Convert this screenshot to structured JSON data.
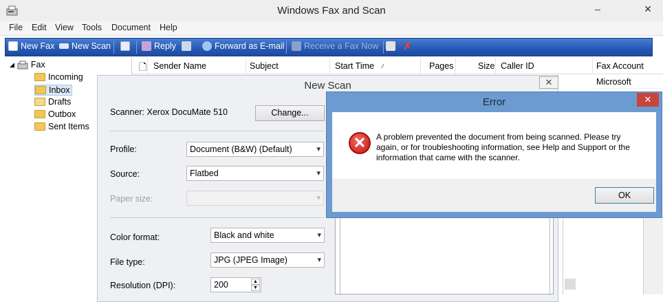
{
  "window": {
    "title": "Windows Fax and Scan",
    "minimize": "–",
    "close": "✕"
  },
  "menu": [
    "File",
    "Edit",
    "View",
    "Tools",
    "Document",
    "Help"
  ],
  "toolbar": {
    "new_fax": "New Fax",
    "new_scan": "New Scan",
    "reply": "Reply",
    "forward_email": "Forward as E-mail",
    "receive_fax": "Receive a Fax Now"
  },
  "tree": {
    "root": "Fax",
    "items": [
      "Incoming",
      "Inbox",
      "Drafts",
      "Outbox",
      "Sent Items"
    ]
  },
  "list": {
    "columns": [
      "Sender Name",
      "Subject",
      "Start Time",
      "Pages",
      "Size",
      "Caller ID",
      "Fax Account"
    ],
    "rows": [
      {
        "fax_account": "Microsoft"
      }
    ]
  },
  "new_scan": {
    "title": "New Scan",
    "scanner_label": "Scanner: Xerox DocuMate 510",
    "change_button": "Change...",
    "profile_label": "Profile:",
    "profile_value": "Document (B&W) (Default)",
    "source_label": "Source:",
    "source_value": "Flatbed",
    "paper_size_label": "Paper size:",
    "color_format_label": "Color format:",
    "color_format_value": "Black and white",
    "file_type_label": "File type:",
    "file_type_value": "JPG (JPEG Image)",
    "resolution_label": "Resolution (DPI):",
    "resolution_value": "200"
  },
  "error": {
    "title": "Error",
    "message": "A problem prevented the document from being scanned. Please try again, or for troubleshooting information, see Help and Support or the information that came with the scanner.",
    "ok_button": "OK"
  },
  "colors": {
    "toolbar": "#285bb5",
    "error_frame": "#6b9bd0",
    "close_red": "#c7453d"
  }
}
